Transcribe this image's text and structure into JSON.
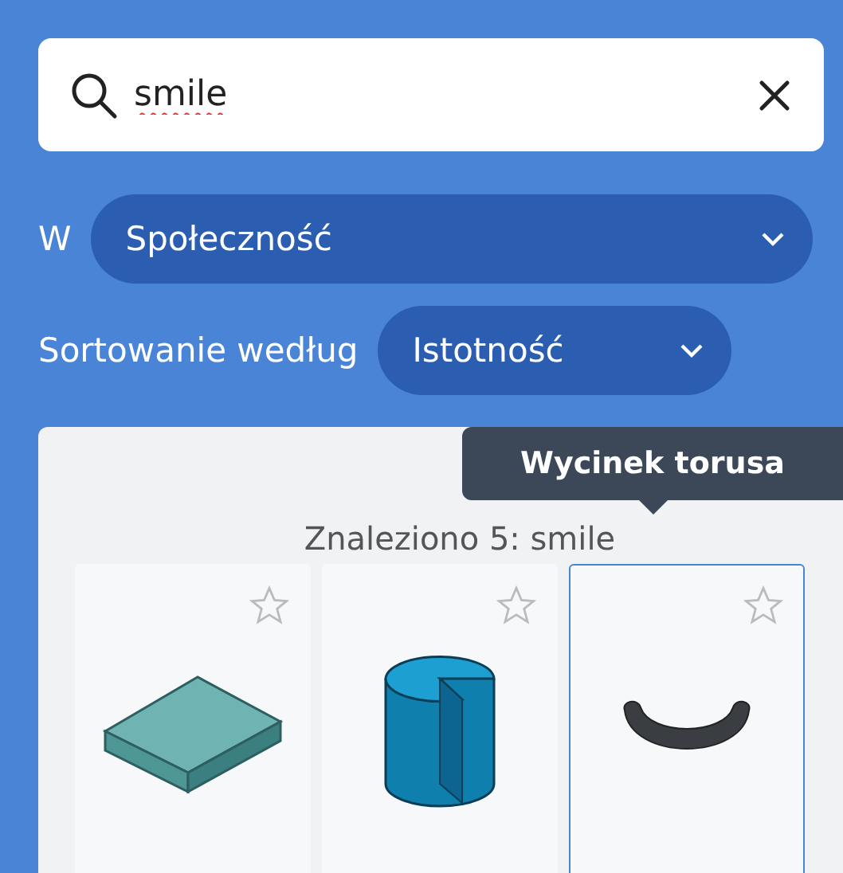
{
  "search": {
    "value": "smile"
  },
  "scope": {
    "label": "W",
    "value": "Społeczność"
  },
  "sort": {
    "label": "Sortowanie według",
    "value": "Istotność"
  },
  "results": {
    "summary": "Znaleziono 5: smile",
    "tooltip": "Wycinek torusa",
    "items": [
      {
        "kind": "box",
        "selected": false
      },
      {
        "kind": "cylinder",
        "selected": false
      },
      {
        "kind": "torus",
        "selected": true
      }
    ]
  }
}
